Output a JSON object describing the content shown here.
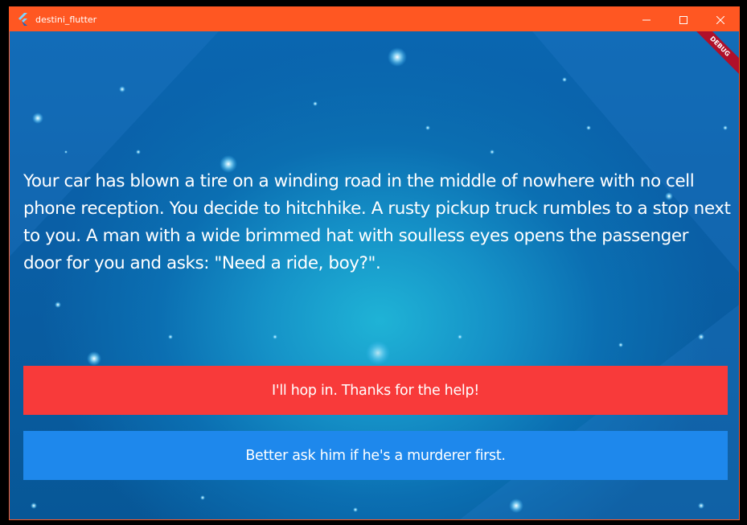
{
  "window": {
    "title": "destini_flutter",
    "icons": {
      "app": "flutter-logo-icon",
      "minimize": "minimize-icon",
      "maximize": "maximize-icon",
      "close": "close-icon"
    },
    "titlebar_color": "#ff5722"
  },
  "banner": {
    "label": "DEBUG"
  },
  "story": {
    "text": "Your car has blown a tire on a winding road in the middle of nowhere with no cell phone reception. You decide to hitchhike. A rusty pickup truck rumbles to a stop next to you. A man with a wide brimmed hat with soulless eyes opens the passenger door for you and asks: \"Need a ride, boy?\"."
  },
  "choices": [
    {
      "label": "I'll hop in. Thanks for the help!",
      "color": "#f83a3a"
    },
    {
      "label": "Better ask him if he's a murderer first.",
      "color": "#1e88ec"
    }
  ]
}
